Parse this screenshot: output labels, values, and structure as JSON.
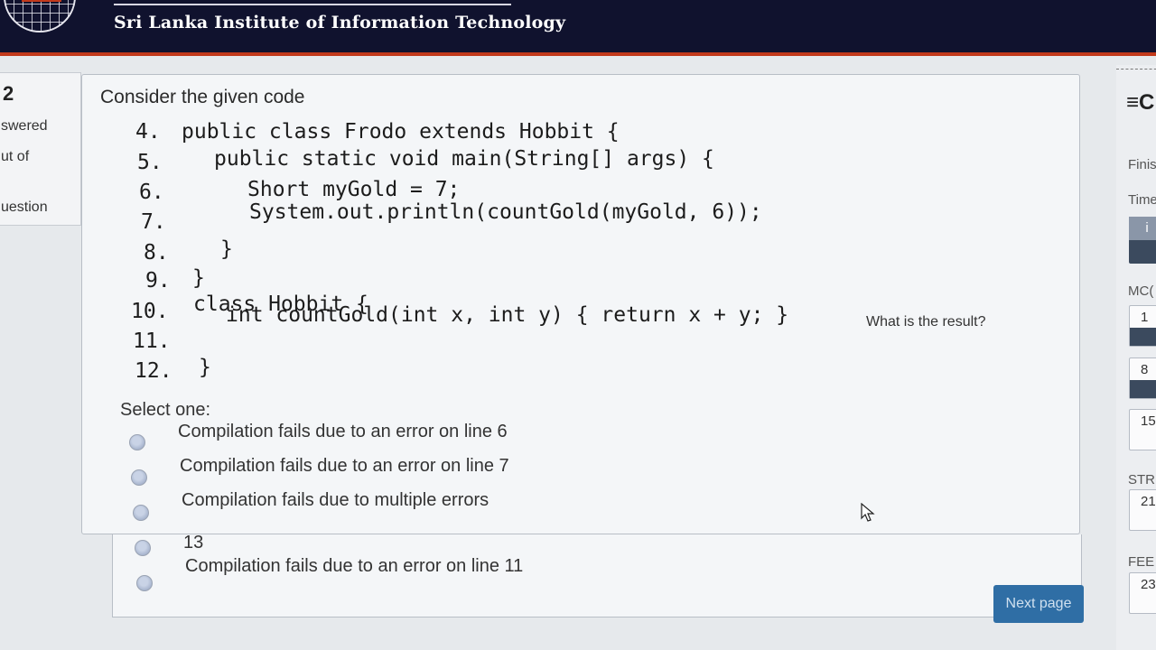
{
  "header": {
    "site_name": "Sri Lanka Institute of Information Technology"
  },
  "question_info": {
    "number": "2",
    "lines": [
      "swered",
      "ut of",
      "uestion"
    ]
  },
  "question": {
    "prompt": "Consider the given code",
    "code_lines": [
      {
        "num": "4.",
        "text": "public class Frodo extends Hobbit {"
      },
      {
        "num": "5.",
        "text": "public static void main(String[] args) {"
      },
      {
        "num": "6.",
        "text": "Short myGold = 7;"
      },
      {
        "num": "7.",
        "text": "System.out.println(countGold(myGold, 6));"
      },
      {
        "num": "8.",
        "text": "}"
      },
      {
        "num": "9.",
        "text": "}"
      },
      {
        "num": "10.",
        "text": "class Hobbit {"
      },
      {
        "num": "11.",
        "text": "int countGold(int x, int y) { return x + y; }"
      },
      {
        "num": "12.",
        "text": "}"
      }
    ],
    "result_question": "What is the result?",
    "select_label": "Select one:",
    "options": [
      "Compilation fails due to an error on line 6",
      "Compilation fails due to an error on line 7",
      "Compilation fails due to multiple errors",
      "13",
      "Compilation fails due to an error on line 11"
    ]
  },
  "nav": {
    "menu_icon": "≡C",
    "finish_text": "Finis",
    "time_text": "Time",
    "info_icon": "i",
    "section_mcq": "MC(",
    "section_str": "STR",
    "section_fee": "FEE",
    "question_numbers": [
      "1",
      "8",
      "15",
      "21",
      "23"
    ]
  },
  "footer": {
    "next_label": "Next page"
  },
  "colors": {
    "header_bg": "#10122e",
    "header_accent": "#c2391b",
    "button_bg": "#2f6ea5"
  }
}
